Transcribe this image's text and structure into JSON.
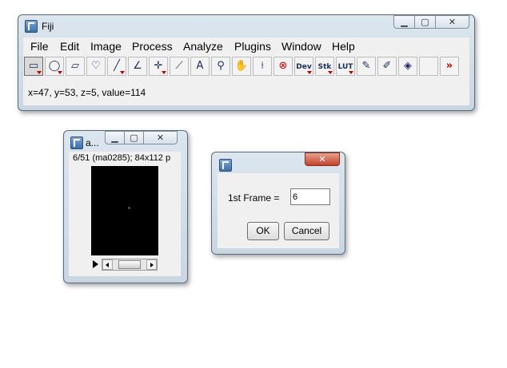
{
  "fiji": {
    "title": "Fiji",
    "menu": [
      "File",
      "Edit",
      "Image",
      "Process",
      "Analyze",
      "Plugins",
      "Window",
      "Help"
    ],
    "tools": [
      {
        "name": "rectangle-tool-icon",
        "glyph": "▭",
        "tri": true,
        "selected": true
      },
      {
        "name": "oval-tool-icon",
        "glyph": "◯",
        "tri": true
      },
      {
        "name": "polygon-tool-icon",
        "glyph": "▱",
        "tri": false
      },
      {
        "name": "freehand-tool-icon",
        "glyph": "♡",
        "tri": false
      },
      {
        "name": "line-tool-icon",
        "glyph": "╱",
        "tri": true
      },
      {
        "name": "angle-tool-icon",
        "glyph": "∠",
        "tri": false
      },
      {
        "name": "point-tool-icon",
        "glyph": "✛",
        "tri": true
      },
      {
        "name": "wand-tool-icon",
        "glyph": "⟋",
        "tri": false
      },
      {
        "name": "text-tool-icon",
        "glyph": "A",
        "tri": false
      },
      {
        "name": "magnifier-tool-icon",
        "glyph": "⚲",
        "tri": false
      },
      {
        "name": "hand-tool-icon",
        "glyph": "✋",
        "tri": false
      },
      {
        "name": "dropper-tool-icon",
        "glyph": "⟊",
        "tri": false
      },
      {
        "name": "stop-tool-icon",
        "glyph": "⊗",
        "tri": false
      },
      {
        "name": "dev-tool-icon",
        "label": "Dev",
        "tri": true
      },
      {
        "name": "stk-tool-icon",
        "label": "Stk",
        "tri": true
      },
      {
        "name": "lut-tool-icon",
        "label": "LUT",
        "tri": true
      },
      {
        "name": "pencil-tool-icon",
        "glyph": "✎",
        "tri": false
      },
      {
        "name": "brush-tool-icon",
        "glyph": "✐",
        "tri": false
      },
      {
        "name": "flood-fill-tool-icon",
        "glyph": "◈",
        "tri": false
      },
      {
        "name": "empty-tool-slot",
        "glyph": "",
        "tri": false
      },
      {
        "name": "more-tools-icon",
        "glyph": "»",
        "tri": false
      }
    ],
    "status": "x=47, y=53, z=5, value=114"
  },
  "image_window": {
    "title": "a...",
    "info": "6/51 (ma0285); 84x112 p"
  },
  "dialog": {
    "label": "1st Frame =",
    "value": "6",
    "ok": "OK",
    "cancel": "Cancel"
  }
}
